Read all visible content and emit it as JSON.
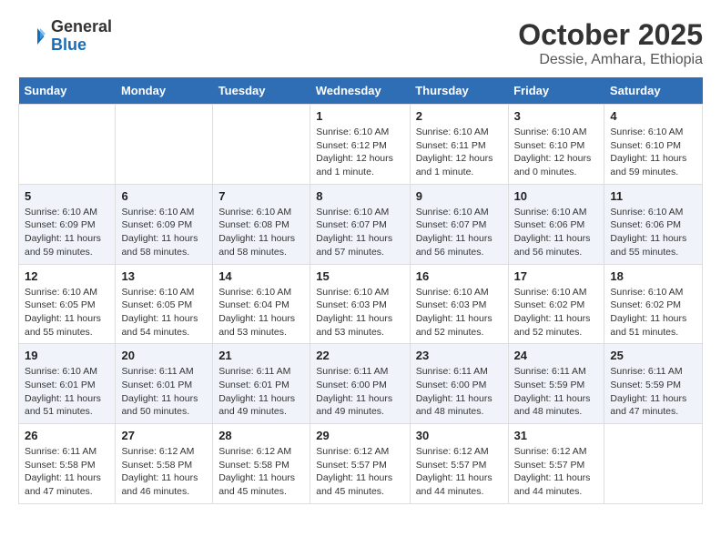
{
  "header": {
    "logo_line1": "General",
    "logo_line2": "Blue",
    "month": "October 2025",
    "location": "Dessie, Amhara, Ethiopia"
  },
  "weekdays": [
    "Sunday",
    "Monday",
    "Tuesday",
    "Wednesday",
    "Thursday",
    "Friday",
    "Saturday"
  ],
  "weeks": [
    [
      {
        "day": "",
        "info": ""
      },
      {
        "day": "",
        "info": ""
      },
      {
        "day": "",
        "info": ""
      },
      {
        "day": "1",
        "info": "Sunrise: 6:10 AM\nSunset: 6:12 PM\nDaylight: 12 hours and 1 minute."
      },
      {
        "day": "2",
        "info": "Sunrise: 6:10 AM\nSunset: 6:11 PM\nDaylight: 12 hours and 1 minute."
      },
      {
        "day": "3",
        "info": "Sunrise: 6:10 AM\nSunset: 6:10 PM\nDaylight: 12 hours and 0 minutes."
      },
      {
        "day": "4",
        "info": "Sunrise: 6:10 AM\nSunset: 6:10 PM\nDaylight: 11 hours and 59 minutes."
      }
    ],
    [
      {
        "day": "5",
        "info": "Sunrise: 6:10 AM\nSunset: 6:09 PM\nDaylight: 11 hours and 59 minutes."
      },
      {
        "day": "6",
        "info": "Sunrise: 6:10 AM\nSunset: 6:09 PM\nDaylight: 11 hours and 58 minutes."
      },
      {
        "day": "7",
        "info": "Sunrise: 6:10 AM\nSunset: 6:08 PM\nDaylight: 11 hours and 58 minutes."
      },
      {
        "day": "8",
        "info": "Sunrise: 6:10 AM\nSunset: 6:07 PM\nDaylight: 11 hours and 57 minutes."
      },
      {
        "day": "9",
        "info": "Sunrise: 6:10 AM\nSunset: 6:07 PM\nDaylight: 11 hours and 56 minutes."
      },
      {
        "day": "10",
        "info": "Sunrise: 6:10 AM\nSunset: 6:06 PM\nDaylight: 11 hours and 56 minutes."
      },
      {
        "day": "11",
        "info": "Sunrise: 6:10 AM\nSunset: 6:06 PM\nDaylight: 11 hours and 55 minutes."
      }
    ],
    [
      {
        "day": "12",
        "info": "Sunrise: 6:10 AM\nSunset: 6:05 PM\nDaylight: 11 hours and 55 minutes."
      },
      {
        "day": "13",
        "info": "Sunrise: 6:10 AM\nSunset: 6:05 PM\nDaylight: 11 hours and 54 minutes."
      },
      {
        "day": "14",
        "info": "Sunrise: 6:10 AM\nSunset: 6:04 PM\nDaylight: 11 hours and 53 minutes."
      },
      {
        "day": "15",
        "info": "Sunrise: 6:10 AM\nSunset: 6:03 PM\nDaylight: 11 hours and 53 minutes."
      },
      {
        "day": "16",
        "info": "Sunrise: 6:10 AM\nSunset: 6:03 PM\nDaylight: 11 hours and 52 minutes."
      },
      {
        "day": "17",
        "info": "Sunrise: 6:10 AM\nSunset: 6:02 PM\nDaylight: 11 hours and 52 minutes."
      },
      {
        "day": "18",
        "info": "Sunrise: 6:10 AM\nSunset: 6:02 PM\nDaylight: 11 hours and 51 minutes."
      }
    ],
    [
      {
        "day": "19",
        "info": "Sunrise: 6:10 AM\nSunset: 6:01 PM\nDaylight: 11 hours and 51 minutes."
      },
      {
        "day": "20",
        "info": "Sunrise: 6:11 AM\nSunset: 6:01 PM\nDaylight: 11 hours and 50 minutes."
      },
      {
        "day": "21",
        "info": "Sunrise: 6:11 AM\nSunset: 6:01 PM\nDaylight: 11 hours and 49 minutes."
      },
      {
        "day": "22",
        "info": "Sunrise: 6:11 AM\nSunset: 6:00 PM\nDaylight: 11 hours and 49 minutes."
      },
      {
        "day": "23",
        "info": "Sunrise: 6:11 AM\nSunset: 6:00 PM\nDaylight: 11 hours and 48 minutes."
      },
      {
        "day": "24",
        "info": "Sunrise: 6:11 AM\nSunset: 5:59 PM\nDaylight: 11 hours and 48 minutes."
      },
      {
        "day": "25",
        "info": "Sunrise: 6:11 AM\nSunset: 5:59 PM\nDaylight: 11 hours and 47 minutes."
      }
    ],
    [
      {
        "day": "26",
        "info": "Sunrise: 6:11 AM\nSunset: 5:58 PM\nDaylight: 11 hours and 47 minutes."
      },
      {
        "day": "27",
        "info": "Sunrise: 6:12 AM\nSunset: 5:58 PM\nDaylight: 11 hours and 46 minutes."
      },
      {
        "day": "28",
        "info": "Sunrise: 6:12 AM\nSunset: 5:58 PM\nDaylight: 11 hours and 45 minutes."
      },
      {
        "day": "29",
        "info": "Sunrise: 6:12 AM\nSunset: 5:57 PM\nDaylight: 11 hours and 45 minutes."
      },
      {
        "day": "30",
        "info": "Sunrise: 6:12 AM\nSunset: 5:57 PM\nDaylight: 11 hours and 44 minutes."
      },
      {
        "day": "31",
        "info": "Sunrise: 6:12 AM\nSunset: 5:57 PM\nDaylight: 11 hours and 44 minutes."
      },
      {
        "day": "",
        "info": ""
      }
    ]
  ]
}
